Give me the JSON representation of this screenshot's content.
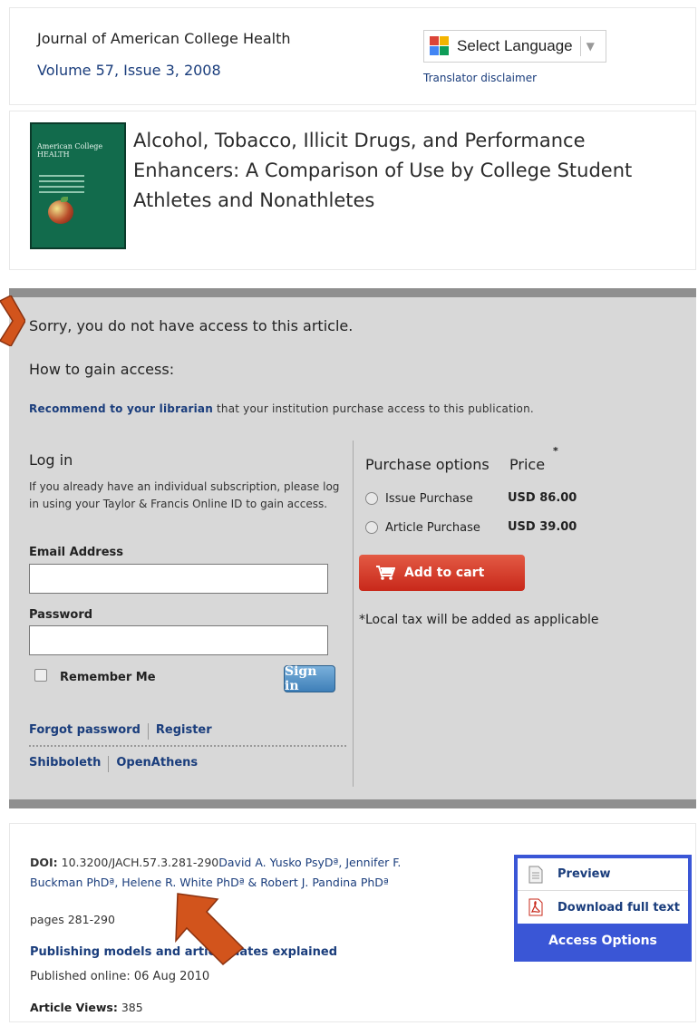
{
  "journal": {
    "title": "Journal of American College Health",
    "volume": "Volume 57, Issue 3, 2008"
  },
  "language": {
    "select_label": "Select Language",
    "disclaimer": "Translator disclaimer"
  },
  "article": {
    "title": "Alcohol, Tobacco, Illicit Drugs, and Performance Enhancers: A Comparison of Use by College Student Athletes and Nonathletes",
    "cover_title": "American College HEALTH"
  },
  "access": {
    "sorry": "Sorry, you do not have access to this article.",
    "how_to": "How to gain access:",
    "recommend_link": "Recommend to your librarian",
    "recommend_rest": " that your institution purchase access to this publication."
  },
  "login": {
    "heading": "Log in",
    "help": "If you already have an individual subscription, please log in using your Taylor & Francis Online ID to gain access.",
    "email_label": "Email Address",
    "email_value": "",
    "password_label": "Password",
    "password_value": "",
    "remember_label": "Remember Me",
    "signin_label": "Sign in",
    "forgot_label": "Forgot password",
    "register_label": "Register",
    "shibboleth_label": "Shibboleth",
    "openathens_label": "OpenAthens"
  },
  "purchase": {
    "heading": "Purchase options",
    "price_heading": "Price",
    "price_star": "*",
    "options": [
      {
        "label": "Issue Purchase",
        "price": "USD 86.00"
      },
      {
        "label": "Article Purchase",
        "price": "USD 39.00"
      }
    ],
    "cart_label": "Add to cart",
    "tax_note": "*Local tax will be added as applicable"
  },
  "info": {
    "doi_label": "DOI:",
    "doi_value": "10.3200/JACH.57.3.281-290",
    "authors": "David A. Yusko PsyDª, Jennifer F. Buckman PhDª, Helene R. White PhDª & Robert J. Pandina PhDª",
    "pages": "pages 281-290",
    "publishing_link": "Publishing models and article dates explained",
    "published": "Published online: 06 Aug 2010",
    "views_label": "Article Views:",
    "views_value": "385"
  },
  "access_widget": {
    "preview_label": "Preview",
    "download_label": "Download full text",
    "options_label": "Access Options"
  },
  "colors": {
    "link": "#1a3d7c",
    "panel": "#d8d8d8",
    "cart": "#c8281a",
    "widget": "#3a56d6",
    "arrow": "#d2541c"
  }
}
